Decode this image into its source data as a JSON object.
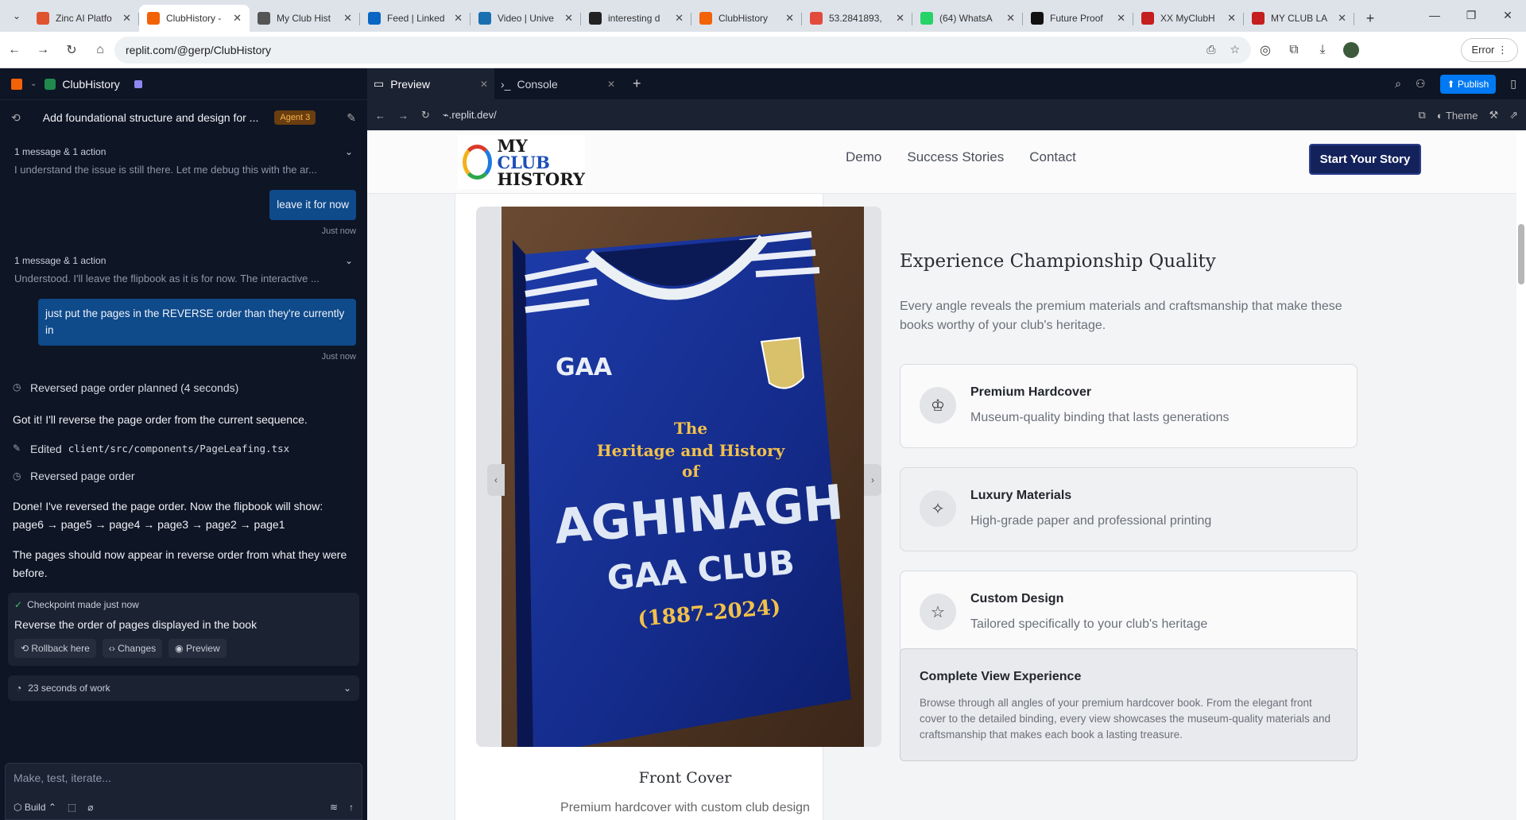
{
  "browser": {
    "tabs": [
      {
        "label": "Zinc AI Platfo",
        "icon": "zinc-icon",
        "color": "#e0532f"
      },
      {
        "label": "ClubHistory -",
        "icon": "replit-icon",
        "color": "#f26207"
      },
      {
        "label": "My Club Hist",
        "icon": "globe-icon",
        "color": "#555555"
      },
      {
        "label": "Feed | Linked",
        "icon": "linkedin-icon",
        "color": "#0a66c2"
      },
      {
        "label": "Video | Unive",
        "icon": "rte-icon",
        "color": "#1a6fb0"
      },
      {
        "label": "interesting d",
        "icon": "github-icon",
        "color": "#222222"
      },
      {
        "label": "ClubHistory",
        "icon": "replit-icon",
        "color": "#f26207"
      },
      {
        "label": "53.2841893,",
        "icon": "maps-icon",
        "color": "#e24b3b"
      },
      {
        "label": "(64) WhatsA",
        "icon": "whatsapp-icon",
        "color": "#25d366"
      },
      {
        "label": "Future Proof",
        "icon": "openai-icon",
        "color": "#111111"
      },
      {
        "label": "XX MyClubH",
        "icon": "pdf-icon",
        "color": "#c41e1e"
      },
      {
        "label": "MY CLUB LA",
        "icon": "pdf-icon",
        "color": "#c41e1e"
      }
    ],
    "url": "replit.com/@gerp/ClubHistory",
    "error_label": "Error"
  },
  "workspace": {
    "project": "ClubHistory",
    "thread_title": "Add foundational structure and design for ...",
    "agent_badge": "Agent 3",
    "msg1_header": "1 message & 1 action",
    "msg1_text": "I understand the issue is still there. Let me debug this with the ar...",
    "user1": "leave it for now",
    "time1": "Just now",
    "msg2_header": "1 message & 1 action",
    "msg2_text": "Understood. I'll leave the flipbook as it is for now. The interactive ...",
    "user2": "just put the pages in the REVERSE order than they're currently in",
    "time2": "Just now",
    "planned": "Reversed page order planned (4 seconds)",
    "reply1": "Got it! I'll reverse the page order from the current sequence.",
    "edited_label": "Edited",
    "edited_file": "client/src/components/PageLeafing.tsx",
    "reversed": "Reversed page order",
    "done1": "Done! I've reversed the page order. Now the flipbook will show:",
    "done2": "page6 → page5 → page4 → page3 → page2 → page1",
    "done3": "The pages should now appear in reverse order from what they were before.",
    "checkpoint": "Checkpoint made just now",
    "checkpoint_desc": "Reverse the order of pages displayed in the book",
    "rollback": "Rollback here",
    "changes": "Changes",
    "preview_btn": "Preview",
    "work": "23 seconds of work",
    "composer_placeholder": "Make, test, iterate...",
    "build": "Build"
  },
  "panes": {
    "preview_tab": "Preview",
    "console_tab": "Console",
    "publish": "Publish",
    "preview_url": ".replit.dev/",
    "theme": "Theme"
  },
  "site": {
    "brand_line1": "MY",
    "brand_line1b": "CLUB",
    "brand_line2": "HISTORY",
    "nav": [
      "Demo",
      "Success Stories",
      "Contact"
    ],
    "cta": "Start Your Story",
    "book_line1": "The",
    "book_line2": "Heritage and History",
    "book_line3": "of",
    "book_line4": "AGHINAGH",
    "book_line5": "GAA CLUB",
    "book_line6": "(1887-2024)",
    "book_logo": "GAA",
    "caption": "Front Cover",
    "caption_sub": "Premium hardcover with custom club design",
    "heading": "Experience Championship Quality",
    "lead": "Every angle reveals the premium materials and craftsmanship that make these books worthy of your club's heritage.",
    "features": [
      {
        "title": "Premium Hardcover",
        "desc": "Museum-quality binding that lasts generations",
        "icon": "award-icon"
      },
      {
        "title": "Luxury Materials",
        "desc": "High-grade paper and professional printing",
        "icon": "sparkles-icon"
      },
      {
        "title": "Custom Design",
        "desc": "Tailored specifically to your club's heritage",
        "icon": "star-icon"
      }
    ],
    "complete_title": "Complete View Experience",
    "complete_desc": "Browse through all angles of your premium hardcover book. From the elegant front cover to the detailed binding, every view showcases the museum-quality materials and craftsmanship that makes each book a lasting treasure."
  }
}
